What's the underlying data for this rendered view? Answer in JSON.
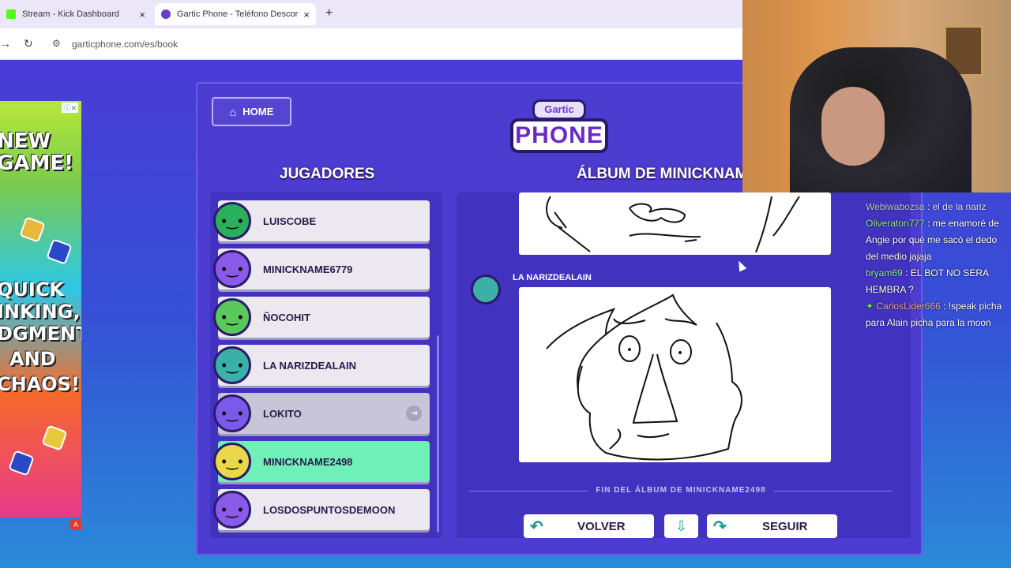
{
  "browser": {
    "tabs": [
      {
        "title": "Stream - Kick Dashboard",
        "close": "×"
      },
      {
        "title": "Gartic Phone - Teléfono Descon",
        "close": "×"
      }
    ],
    "new_tab": "+",
    "url": "garticphone.com/es/book"
  },
  "ad": {
    "line1": "NEW",
    "line2": "GAME!",
    "line3": "QUICK",
    "line4": "INKING,",
    "line5": "DGMENT",
    "line6": "AND",
    "line7": "CHAOS!"
  },
  "game": {
    "home_label": "HOME",
    "logo_top": "Gartic",
    "logo_bottom": "PHONE",
    "players_title": "JUGADORES",
    "album_title": "ÁLBUM DE MINICKNAM",
    "players": [
      {
        "name": "LUISCOBE",
        "state": "normal",
        "color": "#2ab05a"
      },
      {
        "name": "MINICKNAME6779",
        "state": "normal",
        "color": "#8a5ae8"
      },
      {
        "name": "ÑOCOHIT",
        "state": "normal",
        "color": "#5ac85a"
      },
      {
        "name": "LA NARIZDEALAIN",
        "state": "normal",
        "color": "#3ab0a8"
      },
      {
        "name": "LOKITO",
        "state": "dim",
        "color": "#7a5ae8"
      },
      {
        "name": "MINICKNAME2498",
        "state": "active",
        "color": "#e8d84a"
      },
      {
        "name": "LOSDOSPUNTOSDEMOON",
        "state": "normal",
        "color": "#8a5ae8"
      }
    ],
    "drawing_author": "LA NARIZDEALAIN",
    "end_label": "FIN DEL ÁLBUM DE MINICKNAME2498",
    "back_label": "VOLVER",
    "next_label": "SEGUIR"
  },
  "chat": [
    {
      "user": "Webiwabozsa",
      "text": " : el de la nariz",
      "color": "#c8f0c8"
    },
    {
      "user": "Oliveraton777",
      "text": " : me enamoré de Angie por qué me sacó el dedo del medio jajaja",
      "color": "#8af08a"
    },
    {
      "user": "bryam69",
      "text": " : EL BOT NO SERA HEMBRA ?",
      "color": "#8af08a"
    },
    {
      "user": "CarlosLider666",
      "text": " : !speak picha para Alain picha para la moon",
      "color": "#e8a0a8"
    }
  ]
}
